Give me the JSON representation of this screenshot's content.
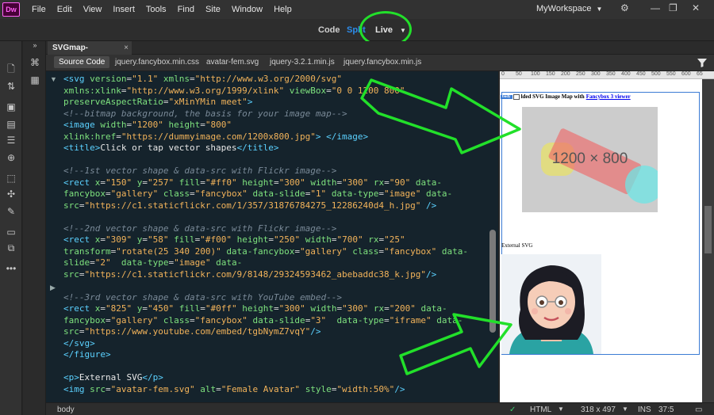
{
  "app": {
    "logo": "Dw"
  },
  "menu": [
    "File",
    "Edit",
    "View",
    "Insert",
    "Tools",
    "Find",
    "Site",
    "Window",
    "Help"
  ],
  "workspace": "MyWorkspace",
  "view_modes": {
    "code": "Code",
    "split": "Split",
    "live": "Live"
  },
  "document_tab": {
    "title": "SVGmap-fancybox.html*"
  },
  "related_files": [
    "Source Code",
    "jquery.fancybox.min.css",
    "avatar-fem.svg",
    "jquery-3.2.1.min.js",
    "jquery.fancybox.min.js"
  ],
  "ruler": [
    "0",
    "50",
    "100",
    "150",
    "200",
    "250",
    "300",
    "350",
    "400",
    "450",
    "500",
    "550",
    "600",
    "65"
  ],
  "preview": {
    "badge": "body",
    "caption_text": "lded SVG Image Map with",
    "caption_link": "Fancybox 3 viewer",
    "dummy_label": "1200 × 800",
    "external_label": "External SVG"
  },
  "status": {
    "tag": "body",
    "language": "HTML",
    "size": "318 x 497",
    "mode": "INS",
    "position": "37:5"
  },
  "colors": {
    "highlight": "#22e02a",
    "accent": "#2d8ceb"
  }
}
